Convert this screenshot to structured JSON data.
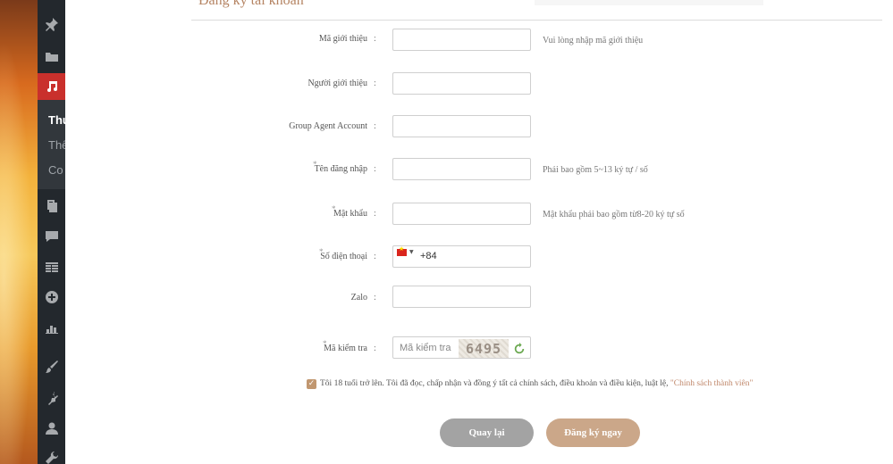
{
  "sidebar": {
    "items": [
      {
        "icon": "pin-icon"
      },
      {
        "icon": "folder-icon"
      },
      {
        "icon": "music-icon"
      },
      {
        "icon": "pages-icon"
      },
      {
        "icon": "comment-icon"
      },
      {
        "icon": "table-icon"
      },
      {
        "icon": "plus-circle-icon"
      },
      {
        "icon": "chart-icon"
      },
      {
        "icon": "brush-icon"
      },
      {
        "icon": "plugin-icon"
      },
      {
        "icon": "user-icon"
      },
      {
        "icon": "wrench-icon"
      }
    ],
    "submenu": [
      "Thư",
      "Thể",
      "Co"
    ]
  },
  "form": {
    "title": "Đăng ký tài khoản",
    "colon": ":",
    "fields": {
      "referral_code": {
        "label": "Mã giới thiệu",
        "hint": "Vui lòng nhập mã giới thiệu"
      },
      "referrer": {
        "label": "Người giới thiệu"
      },
      "group_agent": {
        "label": "Group Agent Account"
      },
      "username": {
        "label": "Tên đăng nhập",
        "hint": "Phải bao gồm 5~13 ký tự / số"
      },
      "password": {
        "label": "Mật khẩu",
        "hint": "Mật khẩu phải bao gồm từ8-20 ký tự số"
      },
      "phone": {
        "label": "Số điện thoại",
        "country_code": "+84"
      },
      "zalo": {
        "label": "Zalo"
      },
      "captcha": {
        "label": "Mã kiểm tra",
        "placeholder": "Mã kiểm tra",
        "code": "6495"
      }
    },
    "agreement": {
      "text": "Tôi 18 tuổi trở lên. Tôi đã đọc, chấp nhận và đồng ý tất cả chính sách, điều khoản và điều kiện, luật lệ, ",
      "link": "\"Chính sách thành viên\""
    },
    "buttons": {
      "back": "Quay lại",
      "register": "Đăng ký ngay"
    }
  },
  "colors": {
    "accent": "#c19770",
    "register_button": "#cba789",
    "back_button": "#a3a3a3",
    "sidebar": "#23282d",
    "active_menu": "#c9302c"
  }
}
